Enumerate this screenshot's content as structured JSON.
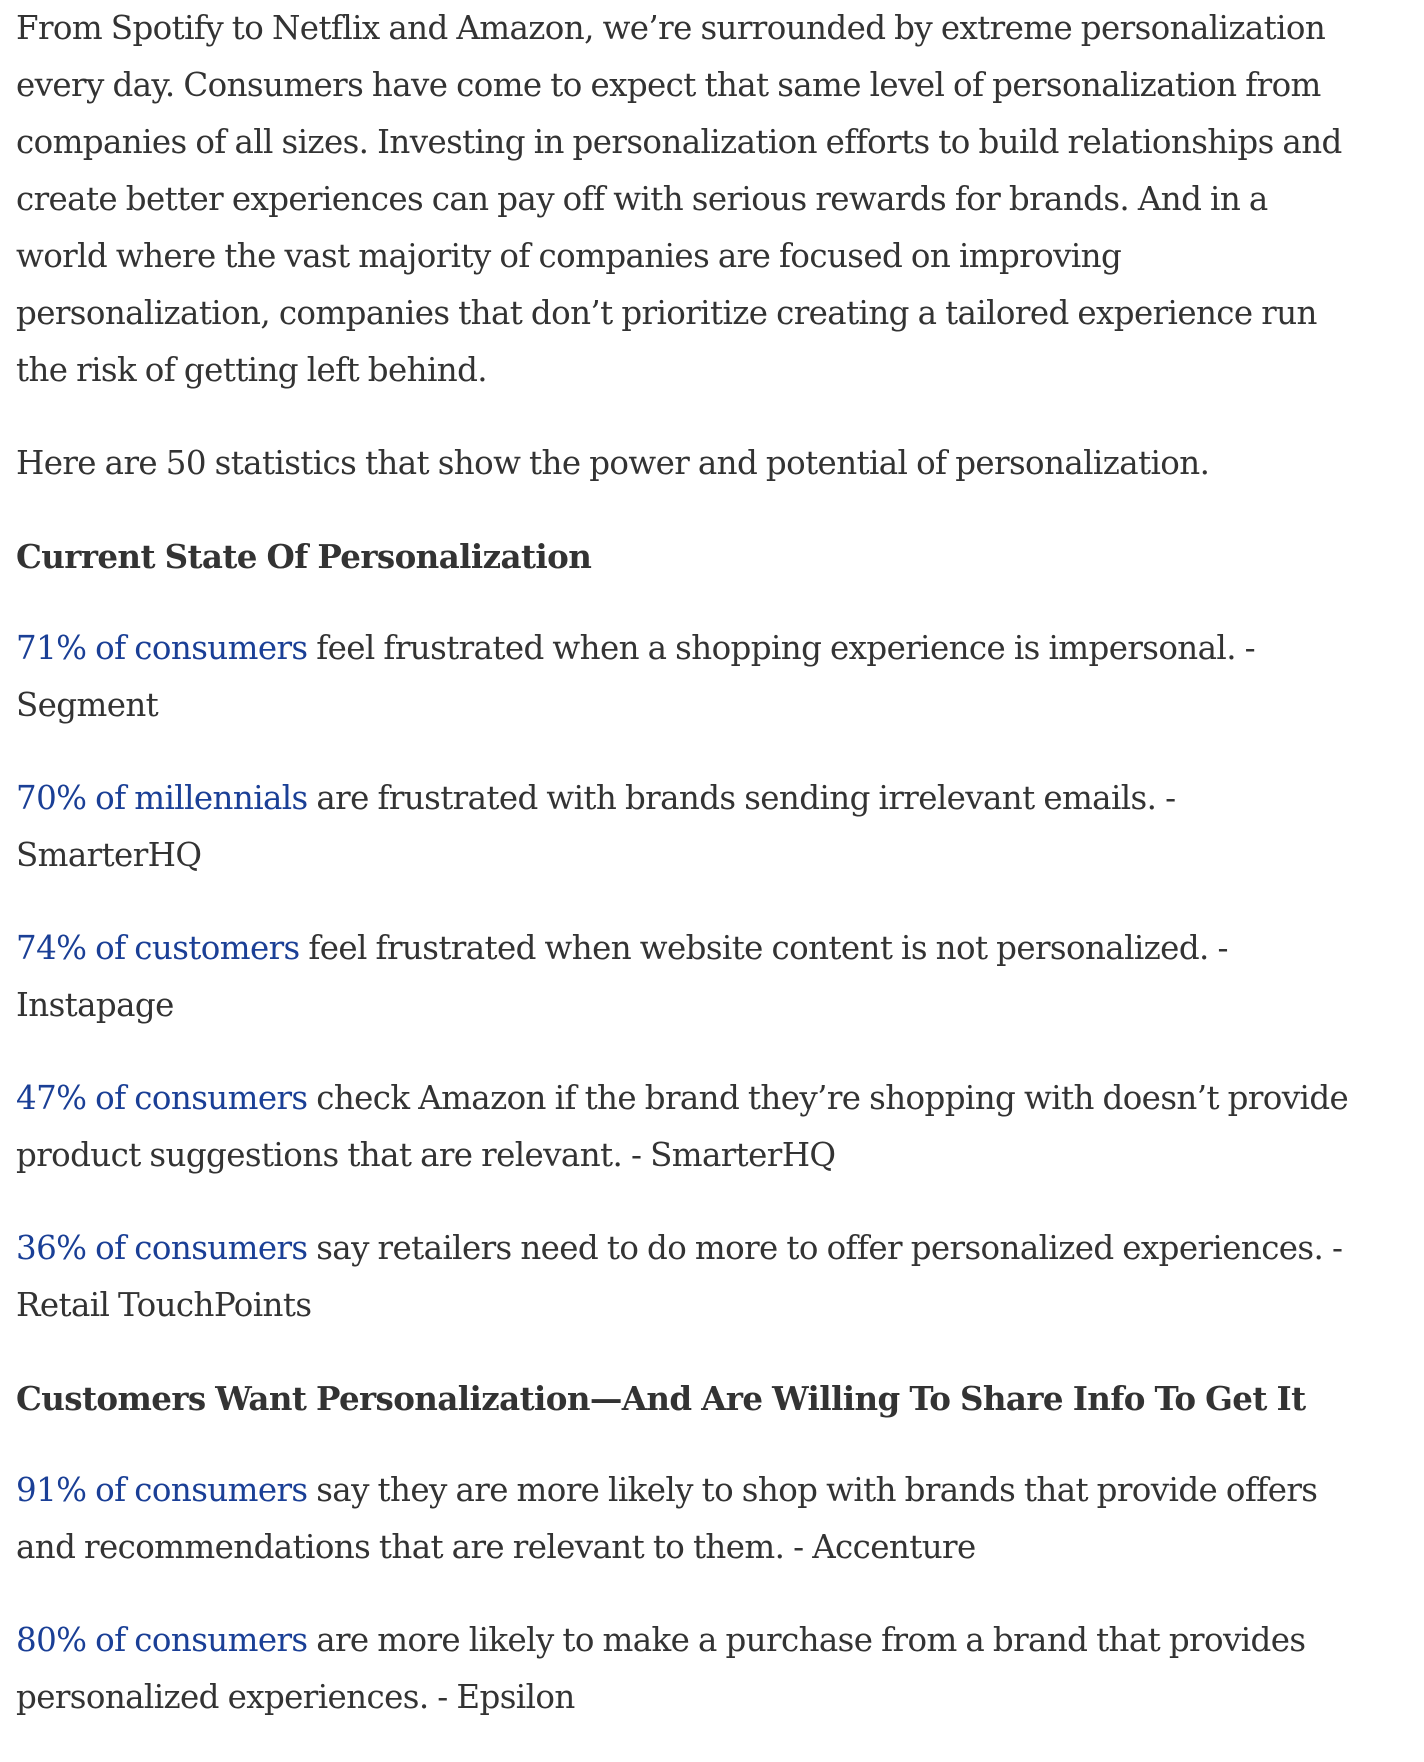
{
  "intro_paragraph": "From Spotify to Netflix and Amazon, we’re surrounded by extreme personalization every day. Consumers have come to expect that same level of personalization from companies of all sizes. Investing in personalization efforts to build relationships and create better experiences can pay off with serious rewards for brands. And in a world where the vast majority of companies are focused on improving personalization, companies that don’t prioritize creating a tailored experience run the risk of getting left behind.",
  "lead_paragraph": "Here are 50 statistics that show the power and potential of personalization.",
  "sections": [
    {
      "heading": "Current State Of Personalization",
      "stats": [
        {
          "link": "71% of consumers",
          "text": " feel frustrated when a shopping experience is impersonal. - Segment"
        },
        {
          "link": "70% of millennials",
          "text": " are frustrated with brands sending irrelevant emails. - SmarterHQ"
        },
        {
          "link": "74% of customers",
          "text": " feel frustrated when website content is not personalized. - Instapage"
        },
        {
          "link": "47% of consumers",
          "text": " check Amazon if the brand they’re shopping with doesn’t provide product suggestions that are relevant. - SmarterHQ"
        },
        {
          "link": "36% of consumers",
          "text": " say retailers need to do more to offer personalized experiences. - Retail TouchPoints"
        }
      ]
    },
    {
      "heading": "Customers Want Personalization—And Are Willing To Share Info To Get It",
      "stats": [
        {
          "link": "91% of consumers",
          "text": " say they are more likely to shop with brands that provide offers and recommendations that are relevant to them. - Accenture"
        },
        {
          "link": "80% of consumers",
          "text": " are more likely to make a purchase from a brand that provides personalized experiences. - Epsilon"
        }
      ]
    }
  ],
  "colors": {
    "text": "#333333",
    "link": "#1a3f96",
    "background": "#ffffff"
  }
}
